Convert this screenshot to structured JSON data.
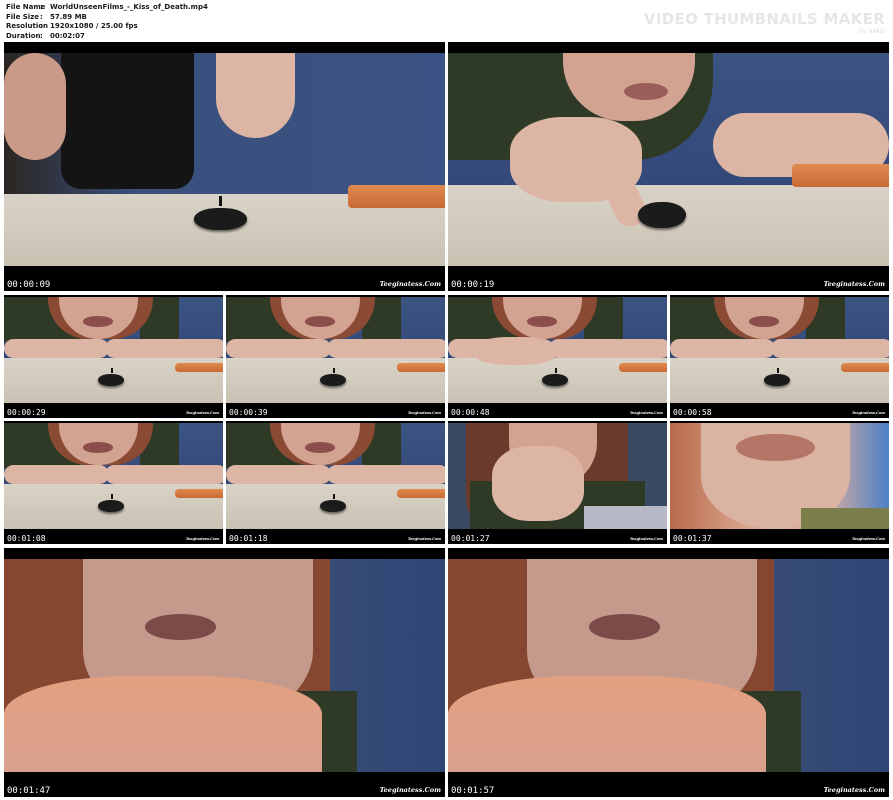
{
  "file_info": {
    "rows": [
      {
        "key": "File Name",
        "sep": ":",
        "value": "WorldUnseenFilms_-_Kiss_of_Death.mp4"
      },
      {
        "key": "File Size",
        "sep": ":",
        "value": "57.89 MB"
      },
      {
        "key": "Resolution",
        "sep": ":",
        "value": "1920x1080 / 25.00 fps"
      },
      {
        "key": "Duration",
        "sep": ":",
        "value": "00:02:07"
      }
    ]
  },
  "brand": {
    "title": "VIDEO THUMBNAILS MAKER",
    "subtitle": "by XAKO"
  },
  "watermark": "Teeginatess.Com",
  "thumbnails": [
    {
      "time": "00:00:09",
      "scene": "wide-puck"
    },
    {
      "time": "00:00:19",
      "scene": "finger-puck"
    },
    {
      "time": "00:00:29",
      "scene": "face-table"
    },
    {
      "time": "00:00:39",
      "scene": "face-table"
    },
    {
      "time": "00:00:48",
      "scene": "face-finger"
    },
    {
      "time": "00:00:58",
      "scene": "face-table"
    },
    {
      "time": "00:01:08",
      "scene": "face-table"
    },
    {
      "time": "00:01:18",
      "scene": "face-table"
    },
    {
      "time": "00:01:27",
      "scene": "hands-kiss"
    },
    {
      "time": "00:01:37",
      "scene": "lips-closeup"
    },
    {
      "time": "00:01:47",
      "scene": "blow-kiss"
    },
    {
      "time": "00:01:57",
      "scene": "blow-kiss"
    }
  ]
}
